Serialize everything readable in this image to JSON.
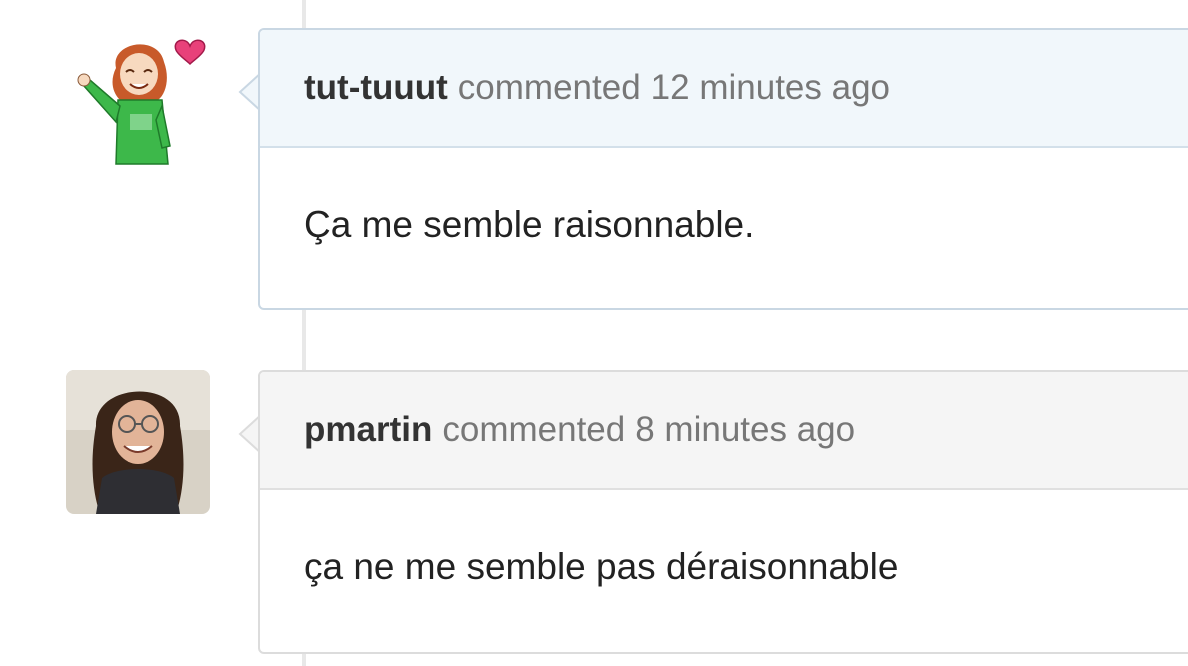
{
  "comments": [
    {
      "author": "tut-tuuut",
      "action": "commented",
      "time": "12 minutes ago",
      "body": "Ça me semble raisonnable."
    },
    {
      "author": "pmartin",
      "action": "commented",
      "time": "8 minutes ago",
      "body": "ça ne me semble pas déraisonnable"
    }
  ]
}
